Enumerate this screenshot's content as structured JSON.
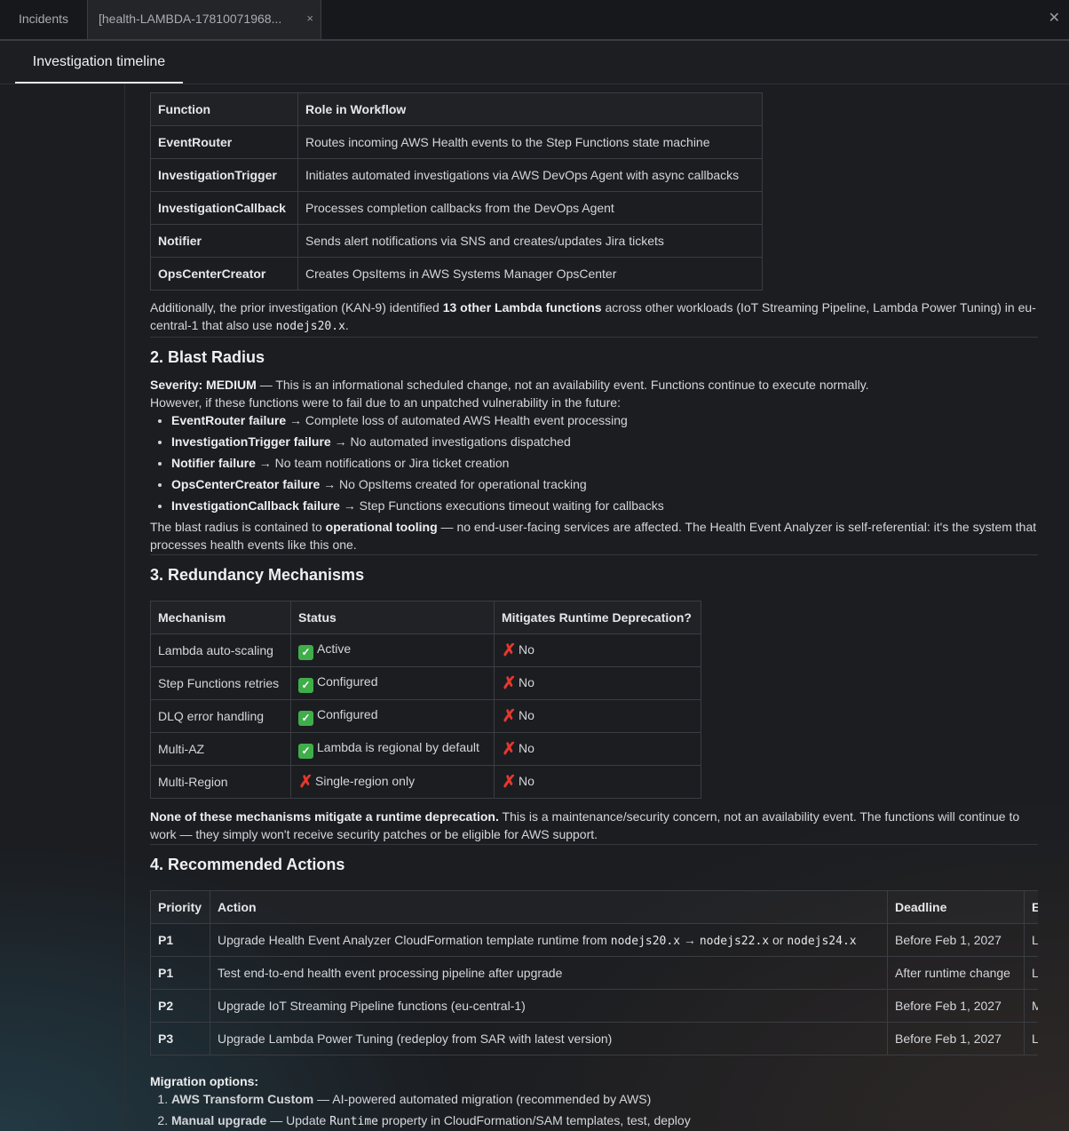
{
  "tabs": {
    "incidents_label": "Incidents",
    "active_label": "[health-LAMBDA-17810071968...",
    "close_glyph": "×"
  },
  "window_close_glyph": "✕",
  "subtab": {
    "label": "Investigation timeline"
  },
  "functions_table": {
    "headers": [
      "Function",
      "Role in Workflow"
    ],
    "rows": [
      [
        "EventRouter",
        "Routes incoming AWS Health events to the Step Functions state machine"
      ],
      [
        "InvestigationTrigger",
        "Initiates automated investigations via AWS DevOps Agent with async callbacks"
      ],
      [
        "InvestigationCallback",
        "Processes completion callbacks from the DevOps Agent"
      ],
      [
        "Notifier",
        "Sends alert notifications via SNS and creates/updates Jira tickets"
      ],
      [
        "OpsCenterCreator",
        "Creates OpsItems in AWS Systems Manager OpsCenter"
      ]
    ]
  },
  "additional_note": {
    "p1": "Additionally, the prior investigation (KAN-9) identified ",
    "b1": "13 other Lambda functions",
    "p2": " across other workloads (IoT Streaming Pipeline, Lambda Power Tuning) in eu-central-1 that also use ",
    "code": "nodejs20.x",
    "p3": "."
  },
  "blast": {
    "heading": "2. Blast Radius",
    "severity_label": "Severity: MEDIUM",
    "severity_text": " — This is an informational scheduled change, not an availability event. Functions continue to execute normally.",
    "however": "However, if these functions were to fail due to an unpatched vulnerability in the future:",
    "items": [
      {
        "b": "EventRouter failure",
        "t": " → Complete loss of automated AWS Health event processing"
      },
      {
        "b": "InvestigationTrigger failure",
        "t": " → No automated investigations dispatched"
      },
      {
        "b": "Notifier failure",
        "t": " → No team notifications or Jira ticket creation"
      },
      {
        "b": "OpsCenterCreator failure",
        "t": " → No OpsItems created for operational tracking"
      },
      {
        "b": "InvestigationCallback failure",
        "t": " → Step Functions executions timeout waiting for callbacks"
      }
    ],
    "contained_p1": "The blast radius is contained to ",
    "contained_b": "operational tooling",
    "contained_p2": " — no end-user-facing services are affected. The Health Event Analyzer is self-referential: it's the system that processes health events like this one."
  },
  "redundancy": {
    "heading": "3. Redundancy Mechanisms",
    "headers": [
      "Mechanism",
      "Status",
      "Mitigates Runtime Deprecation?"
    ],
    "rows": [
      {
        "mechanism": "Lambda auto-scaling",
        "status_icon": "check-icon",
        "status": "Active",
        "mitigates_icon": "cross-icon",
        "mitigates": "No"
      },
      {
        "mechanism": "Step Functions retries",
        "status_icon": "check-icon",
        "status": "Configured",
        "mitigates_icon": "cross-icon",
        "mitigates": "No"
      },
      {
        "mechanism": "DLQ error handling",
        "status_icon": "check-icon",
        "status": "Configured",
        "mitigates_icon": "cross-icon",
        "mitigates": "No"
      },
      {
        "mechanism": "Multi-AZ",
        "status_icon": "check-icon",
        "status": "Lambda is regional by default",
        "mitigates_icon": "cross-icon",
        "mitigates": "No"
      },
      {
        "mechanism": "Multi-Region",
        "status_icon": "cross-icon",
        "status": "Single-region only",
        "mitigates_icon": "cross-icon",
        "mitigates": "No"
      }
    ],
    "note_b": "None of these mechanisms mitigate a runtime deprecation.",
    "note_t": " This is a maintenance/security concern, not an availability event. The functions will continue to work — they simply won't receive security patches or be eligible for AWS support."
  },
  "actions": {
    "heading": "4. Recommended Actions",
    "headers": [
      "Priority",
      "Action",
      "Deadline",
      "E"
    ],
    "rows": [
      {
        "priority": "P1",
        "action_parts": [
          {
            "t": "Upgrade Health Event Analyzer CloudFormation template runtime from "
          },
          {
            "c": "nodejs20.x"
          },
          {
            "t": " → "
          },
          {
            "c": "nodejs22.x"
          },
          {
            "t": " or "
          },
          {
            "c": "nodejs24.x"
          }
        ],
        "deadline": "Before Feb 1, 2027",
        "e": "L"
      },
      {
        "priority": "P1",
        "action_parts": [
          {
            "t": "Test end-to-end health event processing pipeline after upgrade"
          }
        ],
        "deadline": "After runtime change",
        "e": "L"
      },
      {
        "priority": "P2",
        "action_parts": [
          {
            "t": "Upgrade IoT Streaming Pipeline functions (eu-central-1)"
          }
        ],
        "deadline": "Before Feb 1, 2027",
        "e": "M"
      },
      {
        "priority": "P3",
        "action_parts": [
          {
            "t": "Upgrade Lambda Power Tuning (redeploy from SAR with latest version)"
          }
        ],
        "deadline": "Before Feb 1, 2027",
        "e": "L"
      }
    ]
  },
  "migration": {
    "label": "Migration options:",
    "opt1_b": "AWS Transform Custom",
    "opt1_t": " — AI-powered automated migration (recommended by AWS)",
    "opt2_b": "Manual upgrade",
    "opt2_t1": " — Update ",
    "opt2_code": "Runtime",
    "opt2_t2": " property in CloudFormation/SAM templates, test, deploy"
  }
}
